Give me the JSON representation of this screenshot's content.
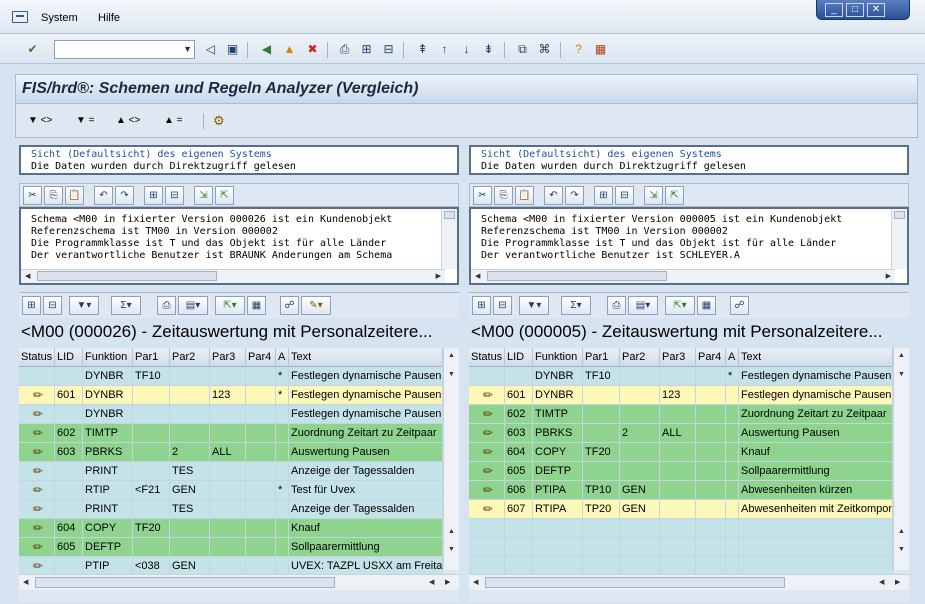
{
  "menu": {
    "items": [
      "System",
      "Hilfe"
    ]
  },
  "title": "FIS/hrd®: Schemen und Regeln Analyzer (Vergleich)",
  "appbar": {
    "buttons": [
      "▼ <>",
      "▼ =",
      "▲ <>",
      "▲ ="
    ]
  },
  "panes": [
    {
      "info": [
        "Sicht (Defaultsicht) des eigenen Systems",
        "Die Daten wurden durch Direktzugriff gelesen"
      ],
      "text": [
        "Schema <M00 in fixierter Version 000026 ist ein Kundenobjekt",
        "Referenzschema ist TM00 in Version 000002",
        "Die Programmklasse ist T und das Objekt ist für alle Länder",
        "Der verantwortliche Benutzer ist BRAUNK Änderungen am Schema"
      ],
      "grid_title": "<M00 (000026) - Zeitauswertung mit Personalzeitere...",
      "columns": [
        "Status",
        "LID",
        "Funktion",
        "Par1",
        "Par2",
        "Par3",
        "Par4",
        "A",
        "Text"
      ],
      "rows": [
        {
          "bg": "#c4e3e8",
          "status": "",
          "lid": "",
          "fn": "DYNBR",
          "p1": "TF10",
          "p2": "",
          "p3": "",
          "p4": "",
          "a": "*",
          "text": "Festlegen dynamische Pausen"
        },
        {
          "bg": "#fdf7b8",
          "status": "pencil",
          "lid": "601",
          "fn": "DYNBR",
          "p1": "",
          "p2": "",
          "p3": "123",
          "p4": "",
          "a": "*",
          "text": "Festlegen dynamische Pausen"
        },
        {
          "bg": "#c4e3e8",
          "status": "pencil",
          "lid": "",
          "fn": "DYNBR",
          "p1": "",
          "p2": "",
          "p3": "",
          "p4": "",
          "a": "",
          "text": "Festlegen dynamische Pausen"
        },
        {
          "bg": "#8fd48e",
          "status": "pencil",
          "lid": "602",
          "fn": "TIMTP",
          "p1": "",
          "p2": "",
          "p3": "",
          "p4": "",
          "a": "",
          "text": "Zuordnung Zeitart zu Zeitpaar"
        },
        {
          "bg": "#8fd48e",
          "status": "pencil",
          "lid": "603",
          "fn": "PBRKS",
          "p1": "",
          "p2": "2",
          "p3": "ALL",
          "p4": "",
          "a": "",
          "text": "Auswertung Pausen"
        },
        {
          "bg": "#c4e3e8",
          "status": "pencil",
          "lid": "",
          "fn": "PRINT",
          "p1": "",
          "p2": "TES",
          "p3": "",
          "p4": "",
          "a": "",
          "text": "Anzeige der Tagessalden"
        },
        {
          "bg": "#c4e3e8",
          "status": "pencil",
          "lid": "",
          "fn": "RTIP",
          "p1": "<F21",
          "p2": "GEN",
          "p3": "",
          "p4": "",
          "a": "*",
          "text": "Test für Uvex"
        },
        {
          "bg": "#c4e3e8",
          "status": "pencil",
          "lid": "",
          "fn": "PRINT",
          "p1": "",
          "p2": "TES",
          "p3": "",
          "p4": "",
          "a": "",
          "text": "Anzeige der Tagessalden"
        },
        {
          "bg": "#8fd48e",
          "status": "pencil",
          "lid": "604",
          "fn": "COPY",
          "p1": "TF20",
          "p2": "",
          "p3": "",
          "p4": "",
          "a": "",
          "text": "Knauf"
        },
        {
          "bg": "#8fd48e",
          "status": "pencil",
          "lid": "605",
          "fn": "DEFTP",
          "p1": "",
          "p2": "",
          "p3": "",
          "p4": "",
          "a": "",
          "text": "Sollpaarermittlung"
        },
        {
          "bg": "#c4e3e8",
          "status": "pencil",
          "lid": "",
          "fn": "PTIP",
          "p1": "<038",
          "p2": "GEN",
          "p3": "",
          "p4": "",
          "a": "",
          "text": "UVEX: TAZPL USXX am Freitag"
        }
      ]
    },
    {
      "info": [
        "Sicht (Defaultsicht) des eigenen Systems",
        "Die Daten wurden durch Direktzugriff gelesen"
      ],
      "text": [
        "Schema <M00 in fixierter Version 000005 ist ein Kundenobjekt",
        "Referenzschema ist TM00 in Version 000002",
        "Die Programmklasse ist T und das Objekt ist für alle Länder",
        "Der verantwortliche Benutzer ist SCHLEYER.A"
      ],
      "grid_title": "<M00 (000005) - Zeitauswertung mit Personalzeitere...",
      "columns": [
        "Status",
        "LID",
        "Funktion",
        "Par1",
        "Par2",
        "Par3",
        "Par4",
        "A",
        "Text"
      ],
      "rows": [
        {
          "bg": "#c4e3e8",
          "status": "",
          "lid": "",
          "fn": "DYNBR",
          "p1": "TF10",
          "p2": "",
          "p3": "",
          "p4": "",
          "a": "*",
          "text": "Festlegen dynamische Pausen"
        },
        {
          "bg": "#fdf7b8",
          "status": "pencil",
          "lid": "601",
          "fn": "DYNBR",
          "p1": "",
          "p2": "",
          "p3": "123",
          "p4": "",
          "a": "",
          "text": "Festlegen dynamische Pausen"
        },
        {
          "bg": "#8fd48e",
          "status": "pencil",
          "lid": "602",
          "fn": "TIMTP",
          "p1": "",
          "p2": "",
          "p3": "",
          "p4": "",
          "a": "",
          "text": "Zuordnung Zeitart zu Zeitpaar"
        },
        {
          "bg": "#8fd48e",
          "status": "pencil",
          "lid": "603",
          "fn": "PBRKS",
          "p1": "",
          "p2": "2",
          "p3": "ALL",
          "p4": "",
          "a": "",
          "text": "Auswertung Pausen"
        },
        {
          "bg": "#8fd48e",
          "status": "pencil",
          "lid": "604",
          "fn": "COPY",
          "p1": "TF20",
          "p2": "",
          "p3": "",
          "p4": "",
          "a": "",
          "text": "Knauf"
        },
        {
          "bg": "#8fd48e",
          "status": "pencil",
          "lid": "605",
          "fn": "DEFTP",
          "p1": "",
          "p2": "",
          "p3": "",
          "p4": "",
          "a": "",
          "text": "Sollpaarermittlung"
        },
        {
          "bg": "#8fd48e",
          "status": "pencil",
          "lid": "606",
          "fn": "PTIPA",
          "p1": "TP10",
          "p2": "GEN",
          "p3": "",
          "p4": "",
          "a": "",
          "text": "Abwesenheiten kürzen"
        },
        {
          "bg": "#fdf7b8",
          "status": "pencil",
          "lid": "607",
          "fn": "RTIPA",
          "p1": "TP20",
          "p2": "GEN",
          "p3": "",
          "p4": "",
          "a": "",
          "text": "Abwesenheiten mit Zeitkomponente"
        },
        {
          "bg": "#c4e3e8",
          "status": "",
          "lid": "",
          "fn": "",
          "p1": "",
          "p2": "",
          "p3": "",
          "p4": "",
          "a": "",
          "text": ""
        },
        {
          "bg": "#c4e3e8",
          "status": "",
          "lid": "",
          "fn": "",
          "p1": "",
          "p2": "",
          "p3": "",
          "p4": "",
          "a": "",
          "text": ""
        },
        {
          "bg": "#c4e3e8",
          "status": "",
          "lid": "",
          "fn": "",
          "p1": "",
          "p2": "",
          "p3": "",
          "p4": "",
          "a": "",
          "text": ""
        }
      ]
    }
  ]
}
